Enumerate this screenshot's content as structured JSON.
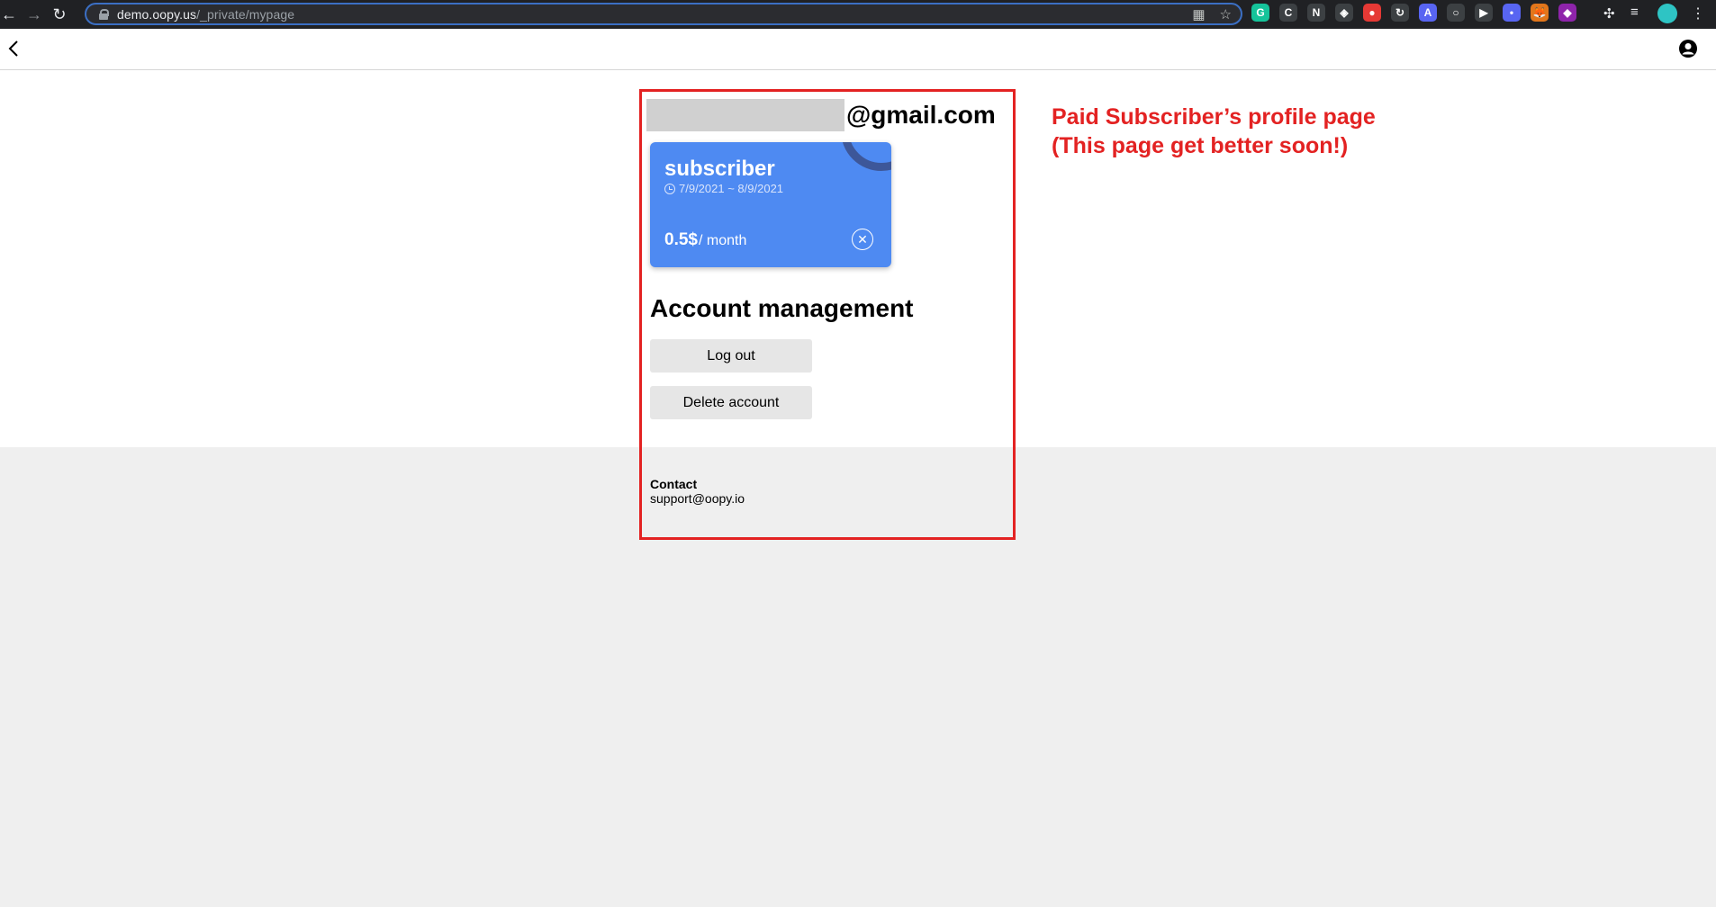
{
  "browser": {
    "url_host": "demo.oopy.us",
    "url_path": "/_private/mypage",
    "extensions": [
      {
        "icon": "grammarly-icon",
        "color": "#15c39a",
        "glyph": "G"
      },
      {
        "icon": "extension-c-icon",
        "color": "#3c4043",
        "glyph": "C"
      },
      {
        "icon": "notion-icon",
        "color": "#3c4043",
        "glyph": "N"
      },
      {
        "icon": "layers-icon",
        "color": "#3c4043",
        "glyph": "◈"
      },
      {
        "icon": "red-extension-icon",
        "color": "#e53935",
        "glyph": "●"
      },
      {
        "icon": "sync-extension-icon",
        "color": "#3c4043",
        "glyph": "↻"
      },
      {
        "icon": "blue-extension-icon",
        "color": "#5865f2",
        "glyph": "A"
      },
      {
        "icon": "circle-extension-icon",
        "color": "#3c4043",
        "glyph": "○"
      },
      {
        "icon": "video-extension-icon",
        "color": "#3c4043",
        "glyph": "▶"
      },
      {
        "icon": "chat-extension-icon",
        "color": "#5865f2",
        "glyph": "•"
      },
      {
        "icon": "metamask-icon",
        "color": "#e2761b",
        "glyph": "🦊"
      },
      {
        "icon": "color-extension-icon",
        "color": "#8e24aa",
        "glyph": "◆"
      }
    ]
  },
  "profile": {
    "email_suffix": "@gmail.com"
  },
  "subscription": {
    "plan_name": "subscriber",
    "period": "7/9/2021 ~ 8/9/2021",
    "price": "0.5$",
    "price_unit": "/ month",
    "card_color": "#4e8af2"
  },
  "account": {
    "title": "Account management",
    "logout_label": "Log out",
    "delete_label": "Delete account"
  },
  "contact": {
    "title": "Contact",
    "email": "support@oopy.io"
  },
  "annotation": {
    "line1": "Paid Subscriber’s profile page",
    "line2": "(This page get better soon!)",
    "color": "#e32222"
  }
}
